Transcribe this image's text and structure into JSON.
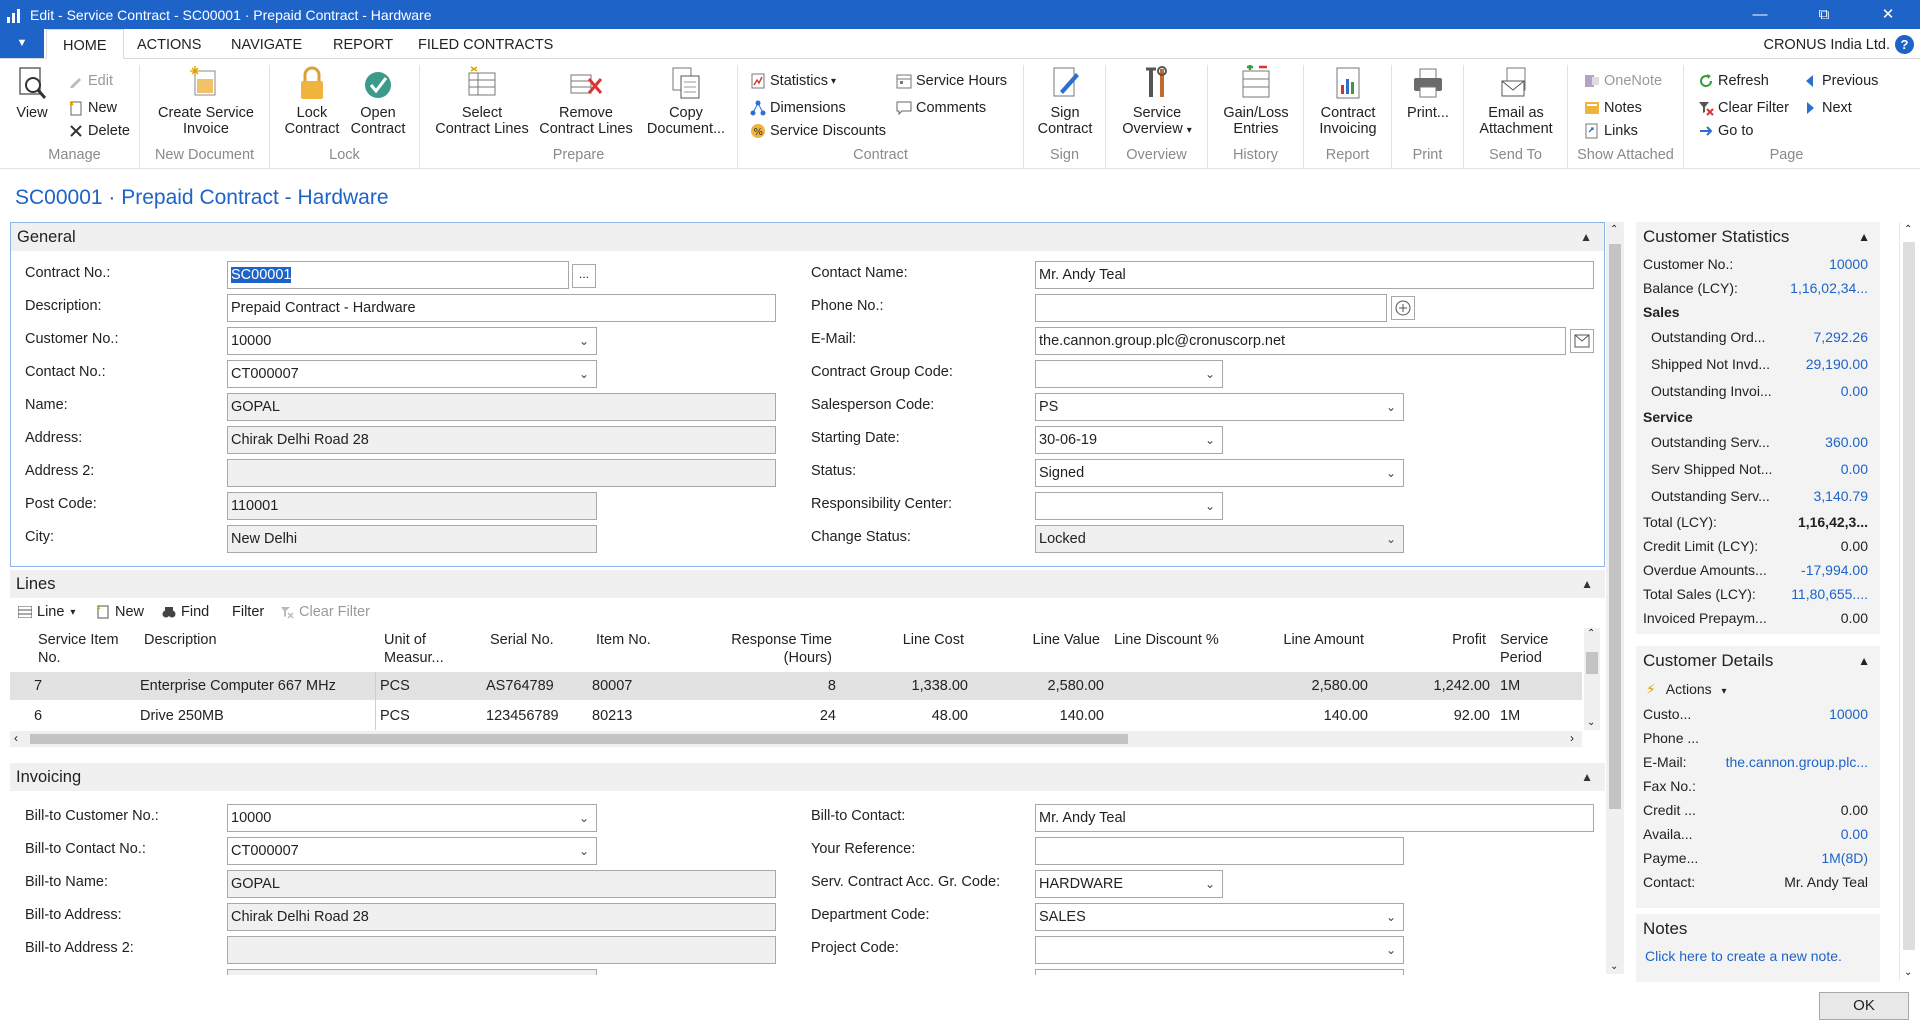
{
  "window": {
    "title": "Edit - Service Contract - SC00001 · Prepaid Contract - Hardware",
    "minimize": "—",
    "restore": "⧉",
    "close": "✕"
  },
  "tabs": {
    "file_button": "▼",
    "items": [
      "HOME",
      "ACTIONS",
      "NAVIGATE",
      "REPORT",
      "FILED CONTRACTS"
    ],
    "active": "HOME",
    "company": "CRONUS India Ltd.",
    "help": "?"
  },
  "ribbon": {
    "manage": {
      "name": "Manage",
      "view": "View",
      "edit": "Edit",
      "new": "New",
      "delete": "Delete"
    },
    "new_document": {
      "name": "New Document",
      "create_line1": "Create Service",
      "create_line2": "Invoice"
    },
    "lock": {
      "name": "Lock",
      "lock_line1": "Lock",
      "lock_line2": "Contract",
      "open_line1": "Open",
      "open_line2": "Contract"
    },
    "prepare": {
      "name": "Prepare",
      "select_line1": "Select",
      "select_line2": "Contract Lines",
      "remove_line1": "Remove",
      "remove_line2": "Contract Lines",
      "copy_line1": "Copy",
      "copy_line2": "Document..."
    },
    "contract": {
      "name": "Contract",
      "statistics": "Statistics",
      "statistics_caret": "▾",
      "dimensions": "Dimensions",
      "service_discounts": "Service Discounts",
      "service_hours": "Service Hours",
      "comments": "Comments"
    },
    "sign": {
      "name": "Sign",
      "btn_line1": "Sign",
      "btn_line2": "Contract"
    },
    "overview": {
      "name": "Overview",
      "btn_line1": "Service",
      "btn_line2": "Overview",
      "caret": "▾"
    },
    "history": {
      "name": "History",
      "btn_line1": "Gain/Loss",
      "btn_line2": "Entries"
    },
    "report": {
      "name": "Report",
      "btn_line1": "Contract",
      "btn_line2": "Invoicing"
    },
    "print": {
      "name": "Print",
      "btn": "Print..."
    },
    "send_to": {
      "name": "Send To",
      "btn_line1": "Email as",
      "btn_line2": "Attachment"
    },
    "show_attached": {
      "name": "Show Attached",
      "onenote": "OneNote",
      "notes": "Notes",
      "links": "Links"
    },
    "page": {
      "name": "Page",
      "refresh": "Refresh",
      "clear_filter": "Clear Filter",
      "goto": "Go to",
      "previous": "Previous",
      "next": "Next"
    }
  },
  "page_title": "SC00001 · Prepaid Contract - Hardware",
  "general": {
    "header": "General",
    "contract_no_label": "Contract No.:",
    "contract_no": "SC00001",
    "assist": "...",
    "description_label": "Description:",
    "description": "Prepaid Contract - Hardware",
    "customer_no_label": "Customer No.:",
    "customer_no": "10000",
    "contact_no_label": "Contact No.:",
    "contact_no": "CT000007",
    "name_label": "Name:",
    "name": "GOPAL",
    "address_label": "Address:",
    "address": "Chirak Delhi Road 28",
    "address2_label": "Address 2:",
    "address2": "",
    "post_code_label": "Post Code:",
    "post_code": "110001",
    "city_label": "City:",
    "city": "New Delhi",
    "contact_name_label": "Contact Name:",
    "contact_name": "Mr. Andy Teal",
    "phone_label": "Phone No.:",
    "phone": "",
    "email_label": "E-Mail:",
    "email": "the.cannon.group.plc@cronuscorp.net",
    "group_code_label": "Contract Group Code:",
    "group_code": "",
    "salesperson_label": "Salesperson Code:",
    "salesperson": "PS",
    "starting_date_label": "Starting Date:",
    "starting_date": "30-06-19",
    "status_label": "Status:",
    "status": "Signed",
    "resp_center_label": "Responsibility Center:",
    "resp_center": "",
    "change_status_label": "Change Status:",
    "change_status": "Locked"
  },
  "lines": {
    "header": "Lines",
    "toolbar": {
      "line": "Line",
      "line_caret": "▾",
      "new": "New",
      "find": "Find",
      "filter": "Filter",
      "clear_filter": "Clear Filter"
    },
    "columns": {
      "service_item_no_1": "Service Item",
      "service_item_no_2": "No.",
      "description": "Description",
      "uom_1": "Unit of",
      "uom_2": "Measur...",
      "serial_no": "Serial No.",
      "item_no": "Item No.",
      "response_time_1": "Response Time",
      "response_time_2": "(Hours)",
      "line_cost": "Line Cost",
      "line_value": "Line Value",
      "line_discount": "Line Discount %",
      "line_amount": "Line Amount",
      "profit": "Profit",
      "service_period_1": "Service",
      "service_period_2": "Period"
    },
    "rows": [
      {
        "service_item_no": "7",
        "description": "Enterprise Computer 667 MHz",
        "uom": "PCS",
        "serial_no": "AS764789",
        "item_no": "80007",
        "response_time": "8",
        "line_cost": "1,338.00",
        "line_value": "2,580.00",
        "line_discount": "",
        "line_amount": "2,580.00",
        "profit": "1,242.00",
        "service_period": "1M"
      },
      {
        "service_item_no": "6",
        "description": "Drive 250MB",
        "uom": "PCS",
        "serial_no": "123456789",
        "item_no": "80213",
        "response_time": "24",
        "line_cost": "48.00",
        "line_value": "140.00",
        "line_discount": "",
        "line_amount": "140.00",
        "profit": "92.00",
        "service_period": "1M"
      }
    ]
  },
  "invoicing": {
    "header": "Invoicing",
    "bill_to_customer_label": "Bill-to Customer No.:",
    "bill_to_customer": "10000",
    "bill_to_contact_no_label": "Bill-to Contact No.:",
    "bill_to_contact_no": "CT000007",
    "bill_to_name_label": "Bill-to Name:",
    "bill_to_name": "GOPAL",
    "bill_to_address_label": "Bill-to Address:",
    "bill_to_address": "Chirak Delhi Road 28",
    "bill_to_address2_label": "Bill-to Address 2:",
    "bill_to_address2": "",
    "bill_to_contact_label": "Bill-to Contact:",
    "bill_to_contact": "Mr. Andy Teal",
    "your_reference_label": "Your Reference:",
    "your_reference": "",
    "acc_gr_code_label": "Serv. Contract Acc. Gr. Code:",
    "acc_gr_code": "HARDWARE",
    "dept_code_label": "Department Code:",
    "dept_code": "SALES",
    "project_code_label": "Project Code:",
    "project_code": ""
  },
  "customer_statistics": {
    "header": "Customer Statistics",
    "customer_no_label": "Customer No.:",
    "customer_no": "10000",
    "balance_label": "Balance (LCY):",
    "balance": "1,16,02,34...",
    "sales_header": "Sales",
    "outstanding_orders_label": "Outstanding Ord...",
    "outstanding_orders": "7,292.26",
    "shipped_not_invd_label": "Shipped Not Invd...",
    "shipped_not_invd": "29,190.00",
    "outstanding_invoices_label": "Outstanding Invoi...",
    "outstanding_invoices": "0.00",
    "service_header": "Service",
    "outstanding_serv1_label": "Outstanding Serv...",
    "outstanding_serv1": "360.00",
    "serv_shipped_label": "Serv Shipped Not...",
    "serv_shipped": "0.00",
    "outstanding_serv2_label": "Outstanding Serv...",
    "outstanding_serv2": "3,140.79",
    "total_label": "Total (LCY):",
    "total": "1,16,42,3...",
    "credit_limit_label": "Credit Limit (LCY):",
    "credit_limit": "0.00",
    "overdue_label": "Overdue Amounts...",
    "overdue": "-17,994.00",
    "total_sales_label": "Total Sales (LCY):",
    "total_sales": "11,80,655....",
    "invoiced_prepaym_label": "Invoiced Prepaym...",
    "invoiced_prepaym": "0.00"
  },
  "customer_details": {
    "header": "Customer Details",
    "actions": "Actions",
    "actions_caret": "▾",
    "customer_label": "Custo...",
    "customer": "10000",
    "phone_label": "Phone ...",
    "phone": "",
    "email_label": "E-Mail:",
    "email": "the.cannon.group.plc...",
    "fax_label": "Fax No.:",
    "fax": "",
    "credit_label": "Credit ...",
    "credit": "0.00",
    "available_label": "Availa...",
    "available": "0.00",
    "payment_label": "Payme...",
    "payment": "1M(8D)",
    "contact_label": "Contact:",
    "contact": "Mr. Andy Teal"
  },
  "notes": {
    "header": "Notes",
    "link": "Click here to create a new note."
  },
  "ok_button": "OK",
  "colors": {
    "accent": "#1e63c7",
    "section_bg": "#f0f0f0",
    "readonly_bg": "#f0f0f0"
  }
}
